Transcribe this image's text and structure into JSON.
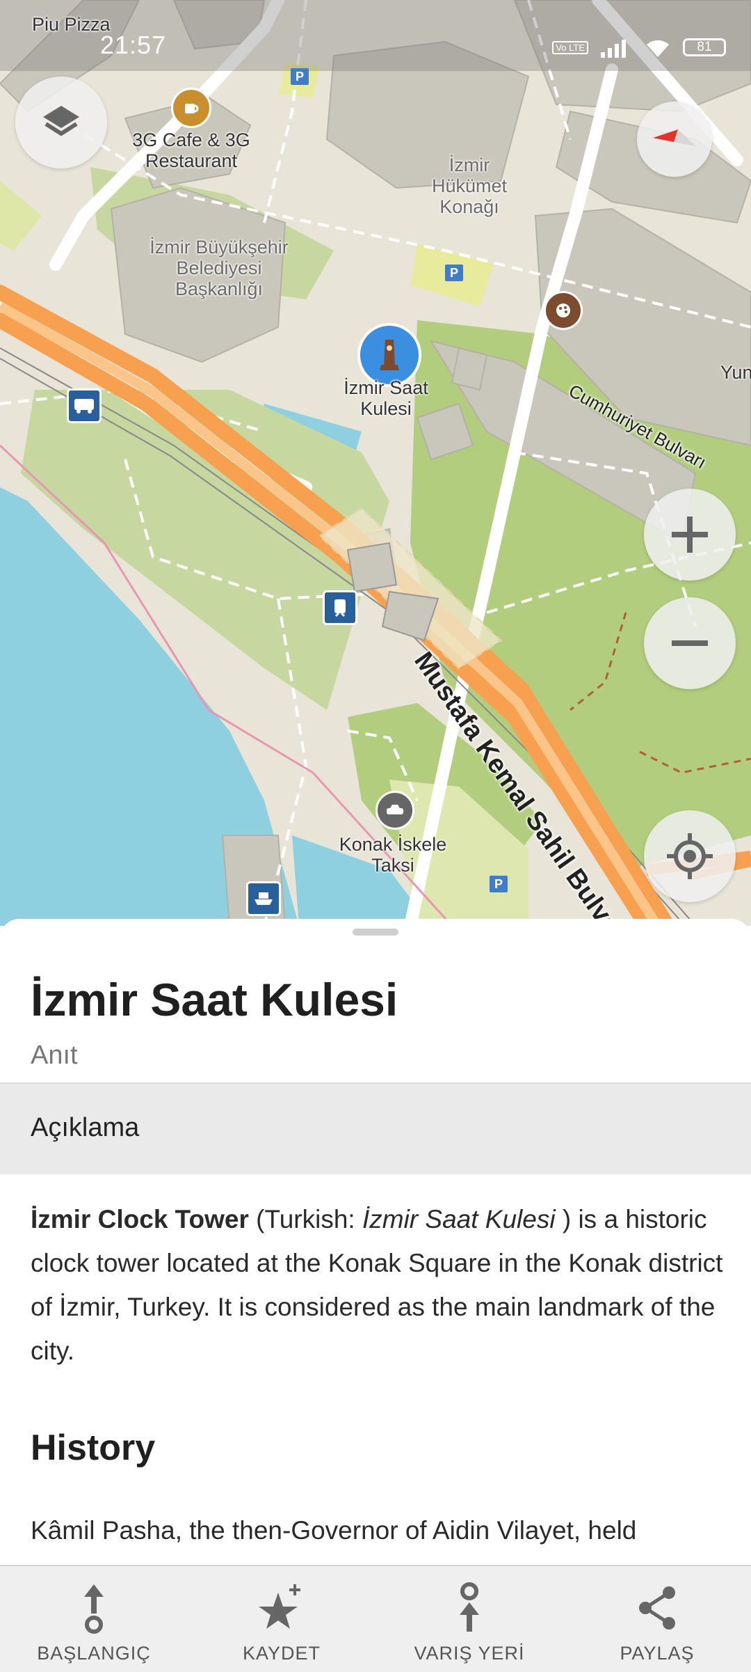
{
  "status_bar": {
    "time": "21:57",
    "battery": "81",
    "volte": "Vo LTE"
  },
  "map": {
    "labels": {
      "piu_pizza": "Piu Pizza",
      "cafe": "3G Cafe & 3G Restaurant",
      "hukumet": "İzmir Hükümet Konağı",
      "belediye": "İzmir Büyükşehir Belediyesi Başkanlığı",
      "saat_kulesi": "İzmir Saat Kulesi",
      "taksi": "Konak İskele Taksi",
      "yun": "Yun",
      "road_cumhuriyet": "Cumhuriyet Bulvarı",
      "road_mustafa": "Mustafa Kemal Sahil Bulvarı"
    },
    "parking_symbol": "P"
  },
  "place": {
    "title": "İzmir Saat Kulesi",
    "category": "Anıt",
    "section_label": "Açıklama",
    "desc_bold": "İzmir Clock Tower",
    "desc_p1": " (Turkish: ",
    "desc_italic": "İzmir Saat Kulesi",
    "desc_p2": " ) is a historic clock tower located at the Konak Square in the Konak district of İzmir, Turkey. It is considered as the main landmark of the city.",
    "history_heading": "History",
    "history_text": "Kâmil Pasha, the then-Governor of Aidin Vilayet, held"
  },
  "bottom_bar": {
    "start": "BAŞLANGIÇ",
    "save": "KAYDET",
    "destination": "VARIŞ YERİ",
    "share": "PAYLAŞ"
  },
  "icons": [
    "layers-icon",
    "compass-icon",
    "zoom-in-icon",
    "zoom-out-icon",
    "my-location-icon",
    "cafe-icon",
    "museum-icon",
    "taxi-icon",
    "bus-icon",
    "tram-icon",
    "ferry-icon",
    "start-icon",
    "star-icon",
    "destination-icon",
    "share-icon"
  ]
}
